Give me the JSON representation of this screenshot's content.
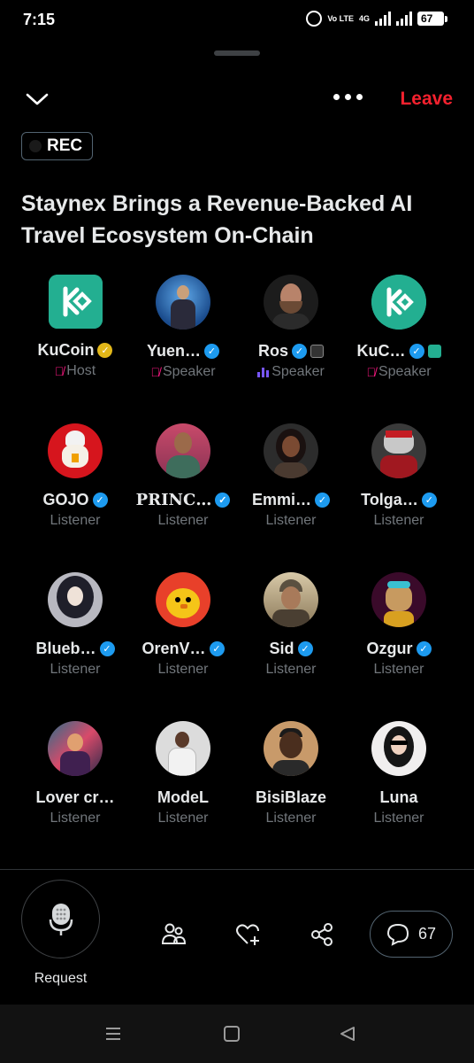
{
  "status_bar": {
    "time": "7:15",
    "network": "Vo LTE",
    "network_type": "4G",
    "battery": "67"
  },
  "header": {
    "leave_label": "Leave",
    "rec_label": "REC"
  },
  "space": {
    "title": "Staynex Brings a Revenue-Backed AI Travel Ecosystem On-Chain"
  },
  "participants": [
    {
      "name": "KuCoin",
      "role": "Host",
      "badge": "gold",
      "muted": true,
      "avatar": "kucoin-logo"
    },
    {
      "name": "Yuen…",
      "role": "Speaker",
      "badge": "blue",
      "muted": true,
      "avatar": "person-on-stage"
    },
    {
      "name": "Ros",
      "role": "Speaker",
      "badge": "blue",
      "muted": false,
      "speaking": true,
      "avatar": "bearded-man"
    },
    {
      "name": "KuC…",
      "role": "Speaker",
      "badge": "blue",
      "muted": true,
      "avatar": "kucoin-logo"
    },
    {
      "name": "GOJO",
      "role": "Listener",
      "badge": "blue",
      "avatar": "red-rooster"
    },
    {
      "name": "PRINC…",
      "role": "Listener",
      "badge": "blue",
      "avatar": "man-portrait"
    },
    {
      "name": "Emmi…",
      "role": "Listener",
      "badge": "blue",
      "avatar": "woman-portrait"
    },
    {
      "name": "Tolga…",
      "role": "Listener",
      "badge": "blue",
      "avatar": "robot-character"
    },
    {
      "name": "Blueb…",
      "role": "Listener",
      "badge": "blue",
      "avatar": "anime-girl"
    },
    {
      "name": "OrenV…",
      "role": "Listener",
      "badge": "blue",
      "avatar": "cartoon-chick"
    },
    {
      "name": "Sid",
      "role": "Listener",
      "badge": "blue",
      "avatar": "warrior"
    },
    {
      "name": "Ozgur",
      "role": "Listener",
      "badge": "blue",
      "avatar": "cartoon-ape"
    },
    {
      "name": "Lover cr…",
      "role": "Listener",
      "badge": "",
      "avatar": "colorful-art"
    },
    {
      "name": "ModeL",
      "role": "Listener",
      "badge": "",
      "avatar": "man-sitting"
    },
    {
      "name": "BisiBlaze",
      "role": "Listener",
      "badge": "",
      "avatar": "young-man"
    },
    {
      "name": "Luna",
      "role": "Listener",
      "badge": "",
      "avatar": "woman-sunglasses"
    }
  ],
  "controls": {
    "request_label": "Request",
    "comment_count": "67"
  }
}
